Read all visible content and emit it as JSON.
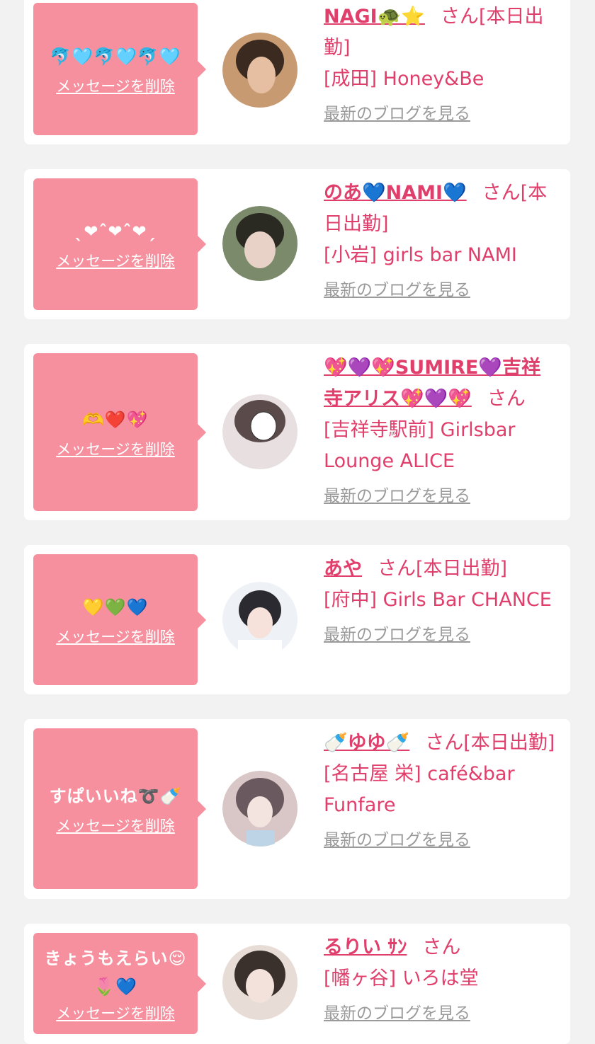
{
  "delete_label": "メッセージを削除",
  "blog_label": "最新のブログを見る",
  "honorific": "さん",
  "colors": {
    "bubble": "#f7909e",
    "accent": "#e03e6b",
    "muted": "#9a9a9a",
    "background": "#f2f2f2"
  },
  "items": [
    {
      "message": "🐬🩵🐬🩵🐬🩵",
      "name": "NAGI🐢⭐️",
      "status": "[本日出勤]",
      "shop": "[成田] Honey&Be",
      "avatar_tones": [
        "#c79a72",
        "#3b2a20"
      ]
    },
    {
      "message": "ˎ❤︎ˆ❤︎ˆ❤︎ˏ",
      "name": "のあ💙NAMI💙",
      "status": "[本日出勤]",
      "shop": "[小岩] girls bar NAMI",
      "avatar_tones": [
        "#7a8a6a",
        "#2a2a22"
      ]
    },
    {
      "message": "🫶❤️💖",
      "name": "💖💜💖SUMIRE💜吉祥寺アリス💖💜💖",
      "status": "",
      "shop": "[吉祥寺駅前] Girlsbar Lounge ALICE",
      "avatar_tones": [
        "#e8e0e0",
        "#5a4a4a"
      ]
    },
    {
      "message": "💛💚💙",
      "name": "あや",
      "status": "[本日出勤]",
      "shop": "[府中] Girls Bar CHANCE",
      "avatar_tones": [
        "#eef1f6",
        "#2a2a30"
      ]
    },
    {
      "message": "すぱいいね➰🍼",
      "name": "🍼ゆゆ🍼",
      "status": "[本日出勤]",
      "shop": "[名古屋 栄] café&bar Funfare",
      "avatar_tones": [
        "#d9c6c6",
        "#6a5a60"
      ]
    },
    {
      "message": "きょうもえらい😌🌷💙",
      "name": "るりい ｻﾝ",
      "status": "",
      "shop": "[幡ヶ谷] いろは堂",
      "avatar_tones": [
        "#e7dcd6",
        "#3a302c"
      ]
    }
  ]
}
